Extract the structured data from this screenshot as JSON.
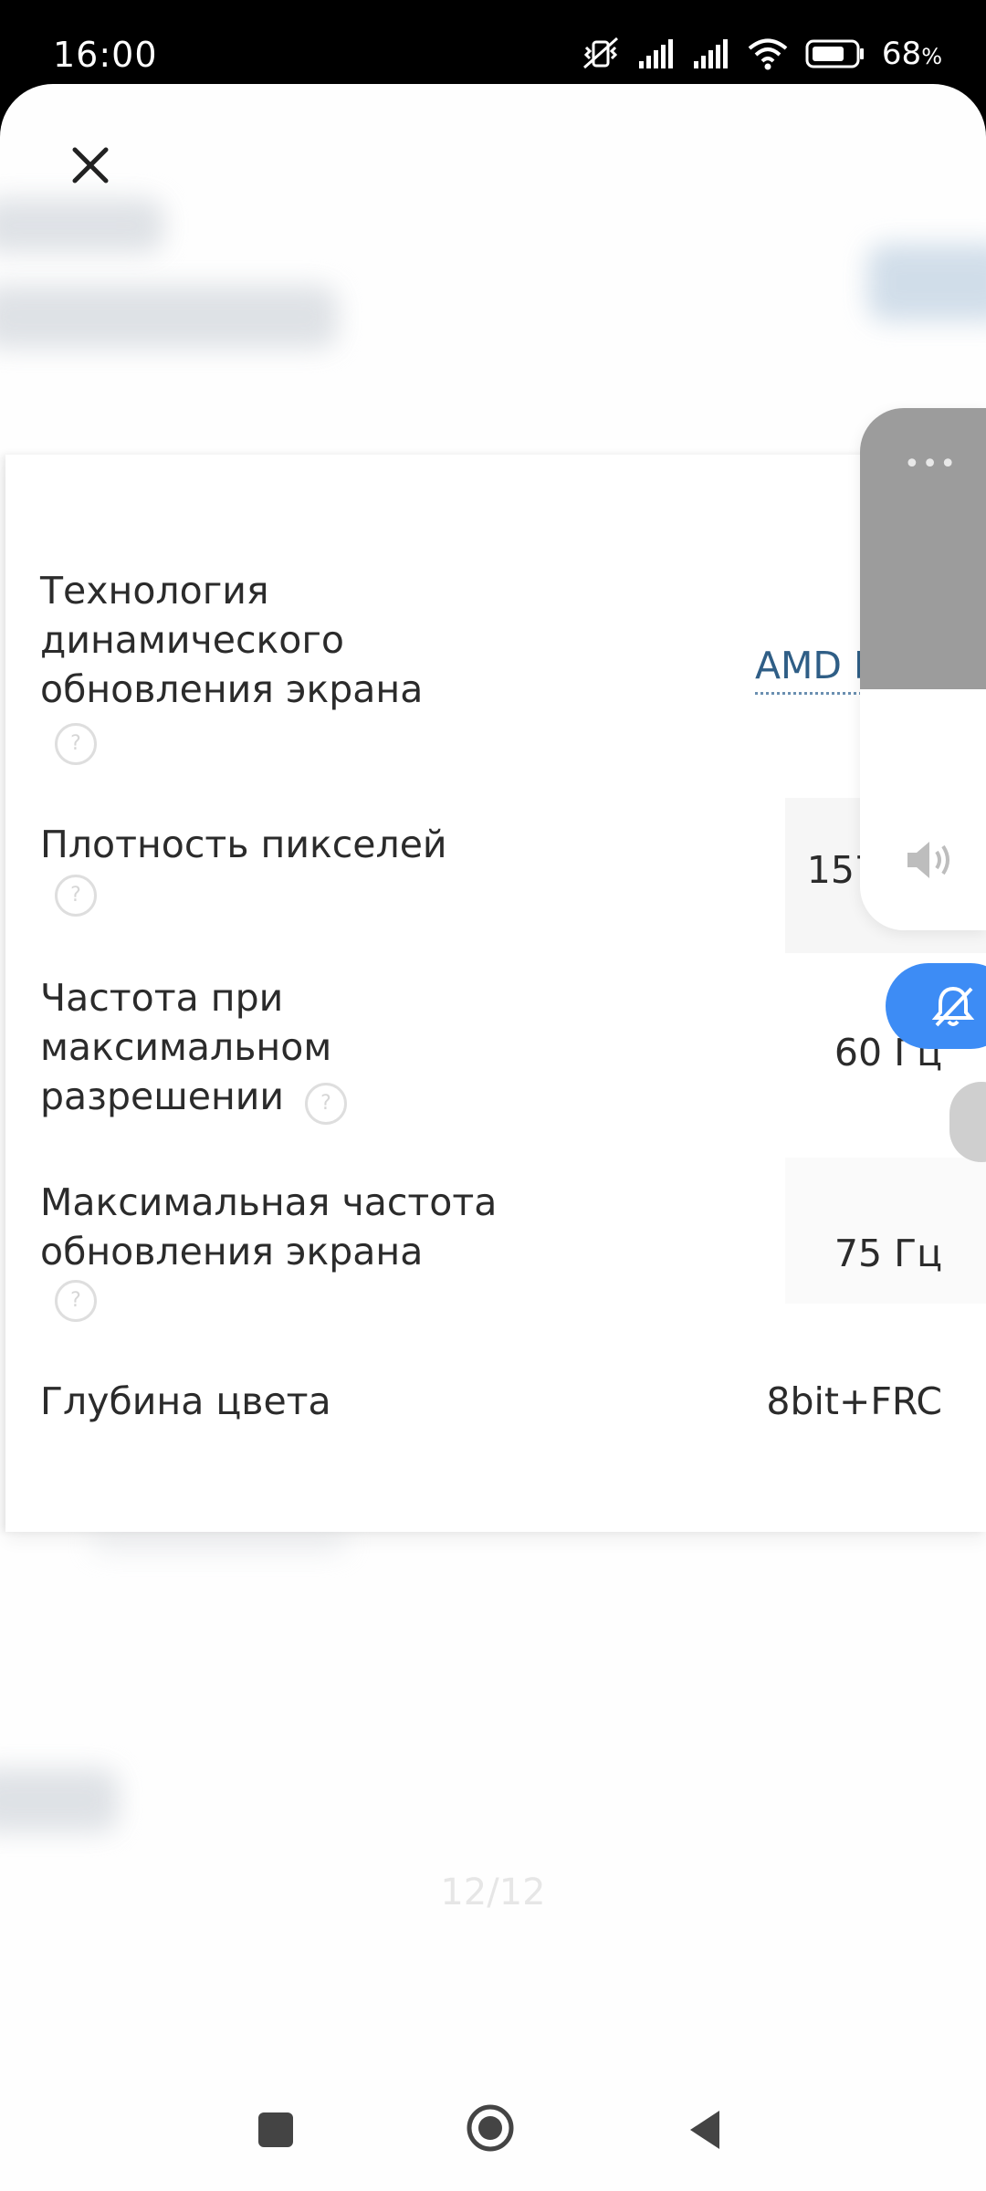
{
  "status_bar": {
    "time": "16:00",
    "battery_percent": "68",
    "battery_suffix": "%",
    "icons": [
      "mute-vibrate-icon",
      "signal-icon",
      "signal-icon",
      "wifi-icon",
      "battery-icon"
    ]
  },
  "specs": [
    {
      "label": "Технология динамического обновления экрана",
      "value": "AMD Free",
      "has_help": true,
      "link": true
    },
    {
      "label": "Плотность пикселей",
      "value": "157",
      "has_help": true,
      "link": false
    },
    {
      "label": "Частота при максимальном разрешении",
      "value": "60 Гц",
      "has_help": true,
      "link": false
    },
    {
      "label": "Максимальная частота обновления экрана",
      "value": "75 Гц",
      "has_help": true,
      "link": false
    },
    {
      "label": "Глубина цвета",
      "value": "8bit+FRC",
      "has_help": false,
      "link": false
    }
  ],
  "help_symbol": "?",
  "volume_panel": {
    "menu_icon": "•••"
  },
  "page_indicator": "12/12",
  "colors": {
    "accent_blue": "#3d8cf5",
    "link": "#2f5e86"
  }
}
